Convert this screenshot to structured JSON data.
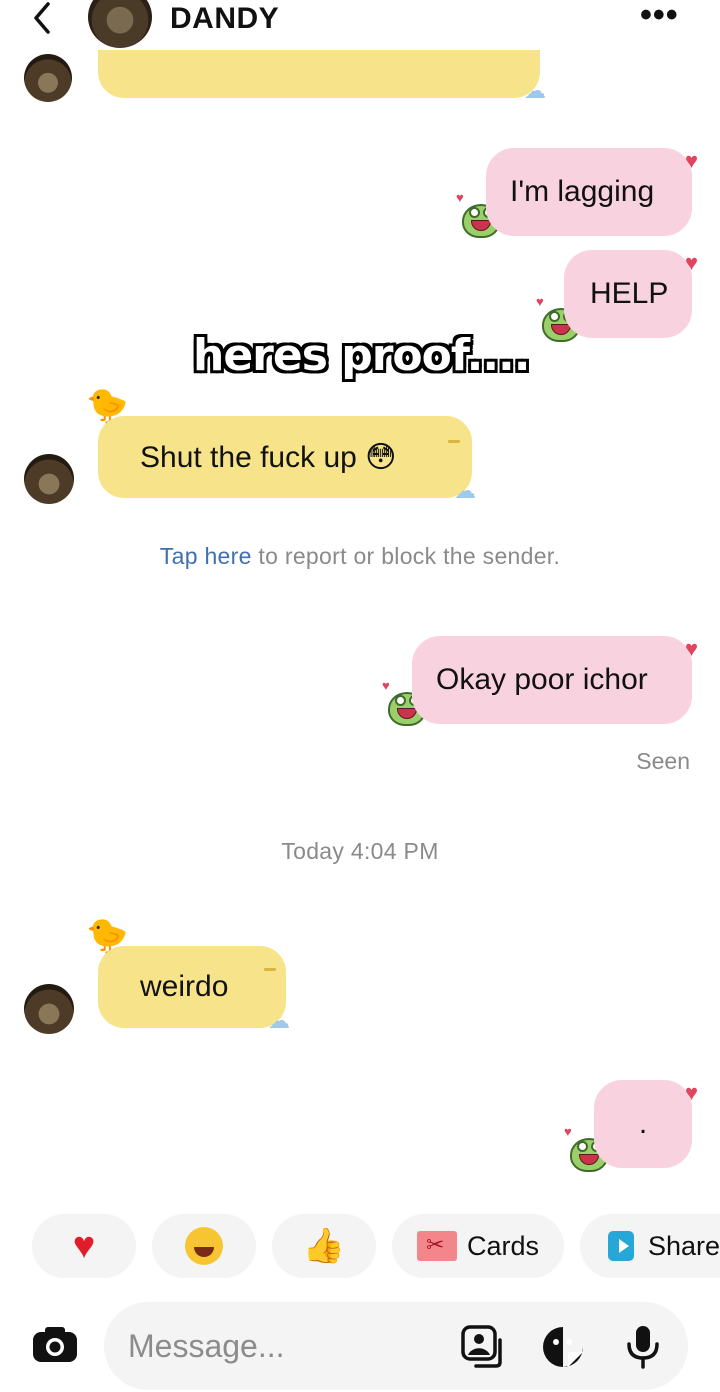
{
  "header": {
    "name": "DANDY",
    "more_label": "•••"
  },
  "messages": [
    {
      "side": "out",
      "text": "I'm lagging"
    },
    {
      "side": "out",
      "text": "HELP"
    },
    {
      "side": "in",
      "text": "Shut the fuck up 😳"
    },
    {
      "side": "out",
      "text": "Okay poor ichor"
    },
    {
      "side": "in",
      "text": "weirdo"
    },
    {
      "side": "out",
      "text": "."
    }
  ],
  "overlay_caption": "heres proof....",
  "report_notice": {
    "link": "Tap here",
    "text": " to report or block the sender."
  },
  "seen_label": "Seen",
  "timestamp": "Today 4:04 PM",
  "quick_reactions": [
    {
      "icon": "heart-emoji"
    },
    {
      "icon": "laughing-emoji"
    },
    {
      "icon": "thumbs-up-emoji"
    },
    {
      "icon": "cards-icon",
      "label": "Cards"
    },
    {
      "icon": "share-icon",
      "label": "Share"
    }
  ],
  "composer": {
    "placeholder": "Message..."
  },
  "colors": {
    "incoming_bubble": "#f7e48a",
    "outgoing_bubble": "#f8d3df",
    "link": "#3f6fb0",
    "heart": "#e0445e"
  }
}
